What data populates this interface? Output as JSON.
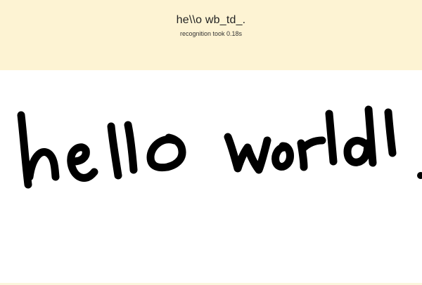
{
  "recognition": {
    "result_text": "he\\\\o wb_td_.",
    "timing_text": "recognition took 0.18s"
  },
  "drawing_canvas": {
    "handwritten_content": "hello world!"
  },
  "colors": {
    "result_panel_background": "#fdf3d3",
    "canvas_background": "#ffffff",
    "ink": "#000000"
  }
}
